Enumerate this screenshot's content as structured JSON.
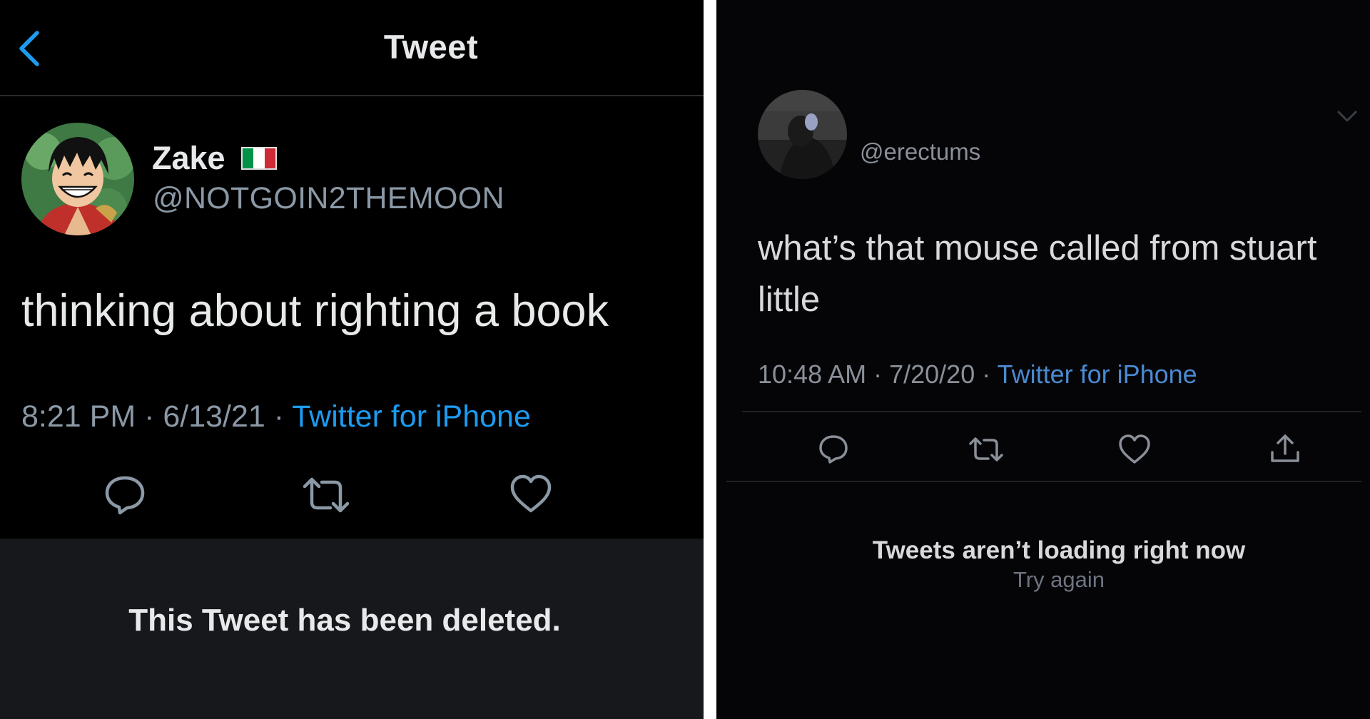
{
  "left_tweet": {
    "header_title": "Tweet",
    "display_name": "Zake",
    "handle": "@NOTGOIN2THEMOON",
    "text": "thinking about righting a book",
    "time": "8:21 PM",
    "date": "6/13/21",
    "separator": " · ",
    "source": "Twitter for iPhone",
    "deleted_notice": "This Tweet has been deleted.",
    "flag_colors": [
      "#009246",
      "#ffffff",
      "#ce2b37"
    ],
    "icons": [
      "back-icon",
      "reply-icon",
      "retweet-icon",
      "like-icon"
    ]
  },
  "right_tweet": {
    "handle": "@erectums",
    "text": "what’s that mouse called from stuart little",
    "time": "10:48 AM",
    "date": "7/20/20",
    "separator": " · ",
    "source": "Twitter for iPhone",
    "error_title": "Tweets aren’t loading right now",
    "retry_label": "Try again",
    "icons": [
      "chevron-down-icon",
      "reply-icon",
      "retweet-icon",
      "like-icon",
      "share-icon"
    ]
  },
  "colors": {
    "background": "#000000",
    "text_primary": "#e7e9ea",
    "text_secondary": "#8b98a5",
    "link_blue": "#1d9bf0",
    "back_blue": "#1d9bf0",
    "deleted_bg": "#17181c"
  }
}
